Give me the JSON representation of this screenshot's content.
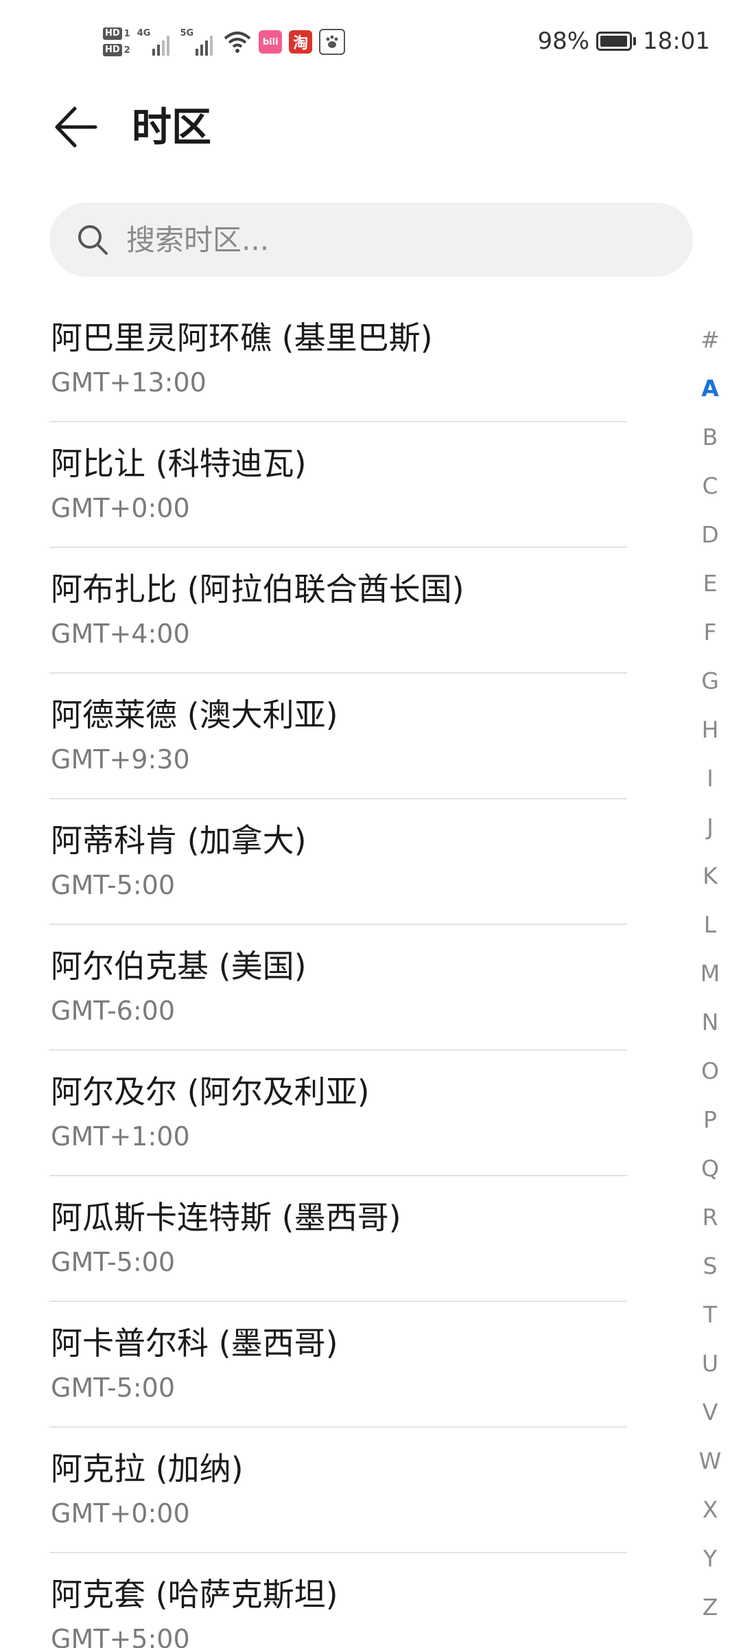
{
  "status_bar": {
    "hd1": "HD",
    "hd1_sub": "1",
    "hd2": "HD",
    "hd2_sub": "2",
    "net1": "4G",
    "net2": "5G",
    "bili_label": "bili",
    "taobao_label": "淘",
    "battery_percent": "98%",
    "battery_level": 0.98,
    "time": "18:01"
  },
  "header": {
    "title": "时区"
  },
  "search": {
    "placeholder": "搜索时区..."
  },
  "timezones": [
    {
      "name": "阿巴里灵阿环礁 (基里巴斯)",
      "offset": "GMT+13:00"
    },
    {
      "name": "阿比让 (科特迪瓦)",
      "offset": "GMT+0:00"
    },
    {
      "name": "阿布扎比 (阿拉伯联合酋长国)",
      "offset": "GMT+4:00"
    },
    {
      "name": "阿德莱德 (澳大利亚)",
      "offset": "GMT+9:30"
    },
    {
      "name": "阿蒂科肯 (加拿大)",
      "offset": "GMT-5:00"
    },
    {
      "name": "阿尔伯克基 (美国)",
      "offset": "GMT-6:00"
    },
    {
      "name": "阿尔及尔 (阿尔及利亚)",
      "offset": "GMT+1:00"
    },
    {
      "name": "阿瓜斯卡连特斯 (墨西哥)",
      "offset": "GMT-5:00"
    },
    {
      "name": "阿卡普尔科 (墨西哥)",
      "offset": "GMT-5:00"
    },
    {
      "name": "阿克拉 (加纳)",
      "offset": "GMT+0:00"
    },
    {
      "name": "阿克套 (哈萨克斯坦)",
      "offset": "GMT+5:00"
    }
  ],
  "alphabet_index": {
    "letters": [
      "#",
      "A",
      "B",
      "C",
      "D",
      "E",
      "F",
      "G",
      "H",
      "I",
      "J",
      "K",
      "L",
      "M",
      "N",
      "O",
      "P",
      "Q",
      "R",
      "S",
      "T",
      "U",
      "V",
      "W",
      "X",
      "Y",
      "Z"
    ],
    "active": "A",
    "active_color": "#1a73d8"
  }
}
